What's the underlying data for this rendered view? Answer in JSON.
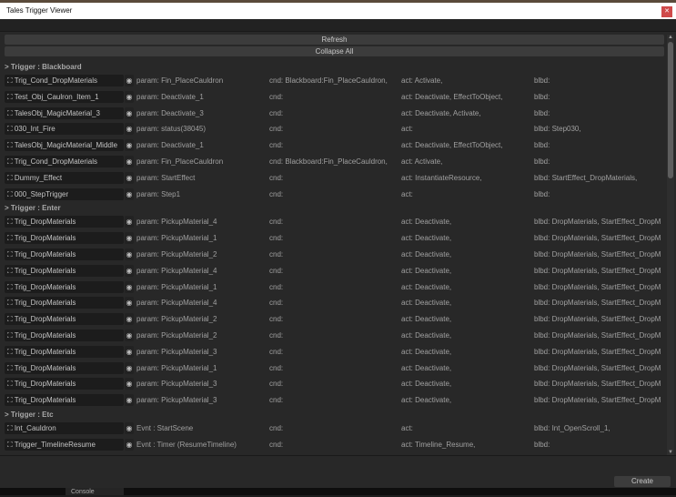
{
  "window": {
    "title": "Tales Trigger Viewer",
    "close": "✕"
  },
  "buttons": {
    "refresh": "Refresh",
    "collapse": "Collapse All",
    "create": "Create"
  },
  "console_tab": "Console",
  "sections": [
    {
      "header": "> Trigger : Blackboard",
      "rows": [
        [
          "Trig_Cond_DropMaterials",
          "param: Fin_PlaceCauldron",
          "cnd: Blackboard:Fin_PlaceCauldron,",
          "act: Activate,",
          "blbd:"
        ],
        [
          "Test_Obj_Caulron_Item_1",
          "param: Deactivate_1",
          "cnd:",
          "act: Deactivate, EffectToObject,",
          "blbd:"
        ],
        [
          "TalesObj_MagicMaterial_3",
          "param: Deactivate_3",
          "cnd:",
          "act: Deactivate, Activate,",
          "blbd:"
        ],
        [
          "030_Int_Fire",
          "param: status(38045)",
          "cnd:",
          "act:",
          "blbd: Step030,"
        ],
        [
          "TalesObj_MagicMaterial_Middle",
          "param: Deactivate_1",
          "cnd:",
          "act: Deactivate, EffectToObject,",
          "blbd:"
        ],
        [
          "Trig_Cond_DropMaterials",
          "param: Fin_PlaceCauldron",
          "cnd: Blackboard:Fin_PlaceCauldron,",
          "act: Activate,",
          "blbd:"
        ],
        [
          "Dummy_Effect",
          "param: StartEffect",
          "cnd:",
          "act: InstantiateResource,",
          "blbd: StartEffect_DropMaterials,"
        ],
        [
          "000_StepTrigger",
          "param: Step1",
          "cnd:",
          "act:",
          "blbd:"
        ]
      ]
    },
    {
      "header": "> Trigger : Enter",
      "rows": [
        [
          "Trig_DropMaterials",
          "param: PickupMaterial_4",
          "cnd:",
          "act: Deactivate,",
          "blbd: DropMaterials, StartEffect_DropM"
        ],
        [
          "Trig_DropMaterials",
          "param: PickupMaterial_1",
          "cnd:",
          "act: Deactivate,",
          "blbd: DropMaterials, StartEffect_DropM"
        ],
        [
          "Trig_DropMaterials",
          "param: PickupMaterial_2",
          "cnd:",
          "act: Deactivate,",
          "blbd: DropMaterials, StartEffect_DropM"
        ],
        [
          "Trig_DropMaterials",
          "param: PickupMaterial_4",
          "cnd:",
          "act: Deactivate,",
          "blbd: DropMaterials, StartEffect_DropM"
        ],
        [
          "Trig_DropMaterials",
          "param: PickupMaterial_1",
          "cnd:",
          "act: Deactivate,",
          "blbd: DropMaterials, StartEffect_DropM"
        ],
        [
          "Trig_DropMaterials",
          "param: PickupMaterial_4",
          "cnd:",
          "act: Deactivate,",
          "blbd: DropMaterials, StartEffect_DropM"
        ],
        [
          "Trig_DropMaterials",
          "param: PickupMaterial_2",
          "cnd:",
          "act: Deactivate,",
          "blbd: DropMaterials, StartEffect_DropM"
        ],
        [
          "Trig_DropMaterials",
          "param: PickupMaterial_2",
          "cnd:",
          "act: Deactivate,",
          "blbd: DropMaterials, StartEffect_DropM"
        ],
        [
          "Trig_DropMaterials",
          "param: PickupMaterial_3",
          "cnd:",
          "act: Deactivate,",
          "blbd: DropMaterials, StartEffect_DropM"
        ],
        [
          "Trig_DropMaterials",
          "param: PickupMaterial_1",
          "cnd:",
          "act: Deactivate,",
          "blbd: DropMaterials, StartEffect_DropM"
        ],
        [
          "Trig_DropMaterials",
          "param: PickupMaterial_3",
          "cnd:",
          "act: Deactivate,",
          "blbd: DropMaterials, StartEffect_DropM"
        ],
        [
          "Trig_DropMaterials",
          "param: PickupMaterial_3",
          "cnd:",
          "act: Deactivate,",
          "blbd: DropMaterials, StartEffect_DropM"
        ]
      ]
    },
    {
      "header": "> Trigger : Etc",
      "rows": [
        [
          "Int_Cauldron",
          "Evnt : StartScene",
          "cnd:",
          "act:",
          "blbd: Int_OpenScroll_1,"
        ],
        [
          "Trigger_TimelineResume",
          "Evnt : Timer (ResumeTimeline)",
          "cnd:",
          "act: Timeline_Resume,",
          "blbd:"
        ],
        [
          "",
          "",
          "",
          "",
          ""
        ]
      ]
    }
  ]
}
